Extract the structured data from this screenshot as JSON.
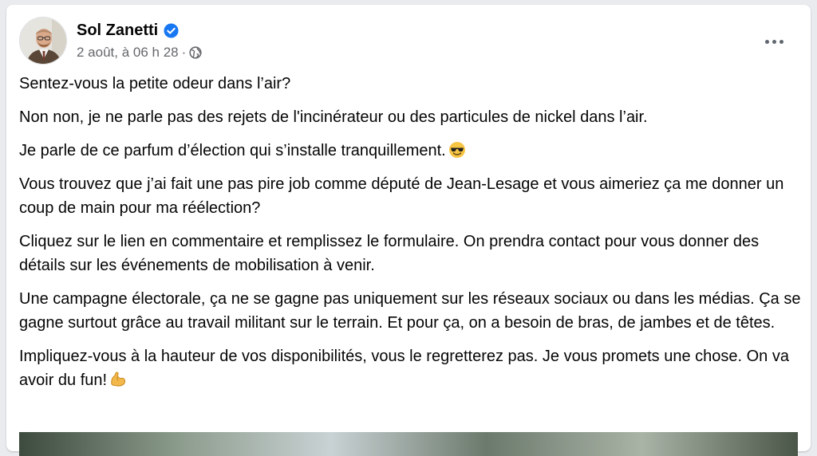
{
  "post": {
    "author": "Sol Zanetti",
    "verified_icon": "verified-badge-icon",
    "timestamp": "2 août, à 06 h 28",
    "separator": "·",
    "audience_icon": "globe-icon",
    "more_icon": "more-options-icon",
    "paragraphs": [
      "Sentez-vous la petite odeur dans l’air?",
      "Non non, je ne parle pas des rejets de l'incinérateur ou des particules de nickel dans l’air.",
      "Je parle de ce parfum d’élection qui s’installe tranquillement.",
      "Vous trouvez que j’ai fait une pas pire job comme député de Jean-Lesage et vous aimeriez ça me donner un coup de main pour ma réélection?",
      "Cliquez sur le lien en commentaire et remplissez le formulaire. On prendra contact pour vous donner des détails sur les événements de mobilisation à venir.",
      "Une campagne électorale, ça ne se gagne pas uniquement sur les réseaux sociaux ou dans les médias. Ça se gagne surtout grâce au travail militant sur le terrain. Et pour ça, on a besoin de bras, de jambes et de têtes.",
      "Impliquez-vous à la hauteur de vos disponibilités, vous le regretterez pas. Je vous promets une chose. On va avoir du fun!"
    ],
    "emojis": {
      "sunglasses": "smiling-face-with-sunglasses-icon",
      "flexed_biceps": "flexed-biceps-icon"
    },
    "colors": {
      "verified_blue": "#1877f2",
      "meta_gray": "#65676b",
      "text": "#050505"
    }
  }
}
